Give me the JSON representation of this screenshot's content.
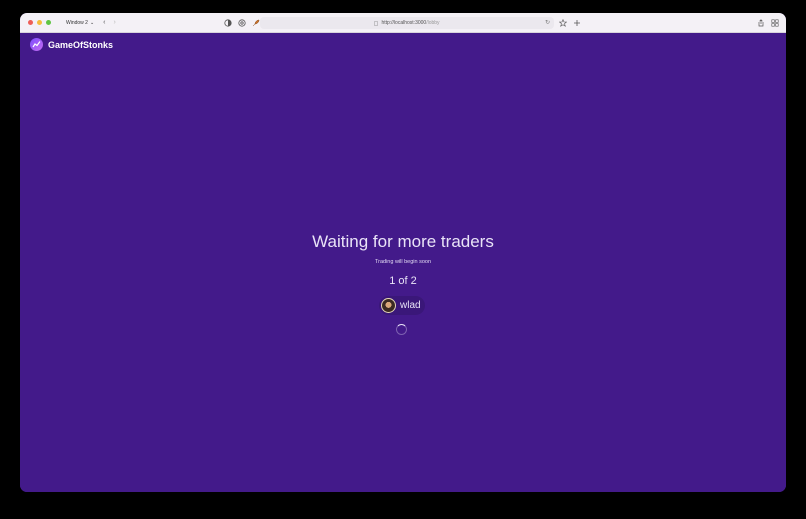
{
  "browser": {
    "window_name": "Window 2",
    "url_host": "http://localhost:3000",
    "url_path": "/lobby"
  },
  "app": {
    "brand": "GameOfStonks"
  },
  "lobby": {
    "headline": "Waiting for more traders",
    "subtitle": "Trading will begin soon",
    "player_count": "1 of 2",
    "players": [
      {
        "name": "wlad"
      }
    ]
  },
  "colors": {
    "background": "#431a8a",
    "accent": "#7c4dff"
  }
}
